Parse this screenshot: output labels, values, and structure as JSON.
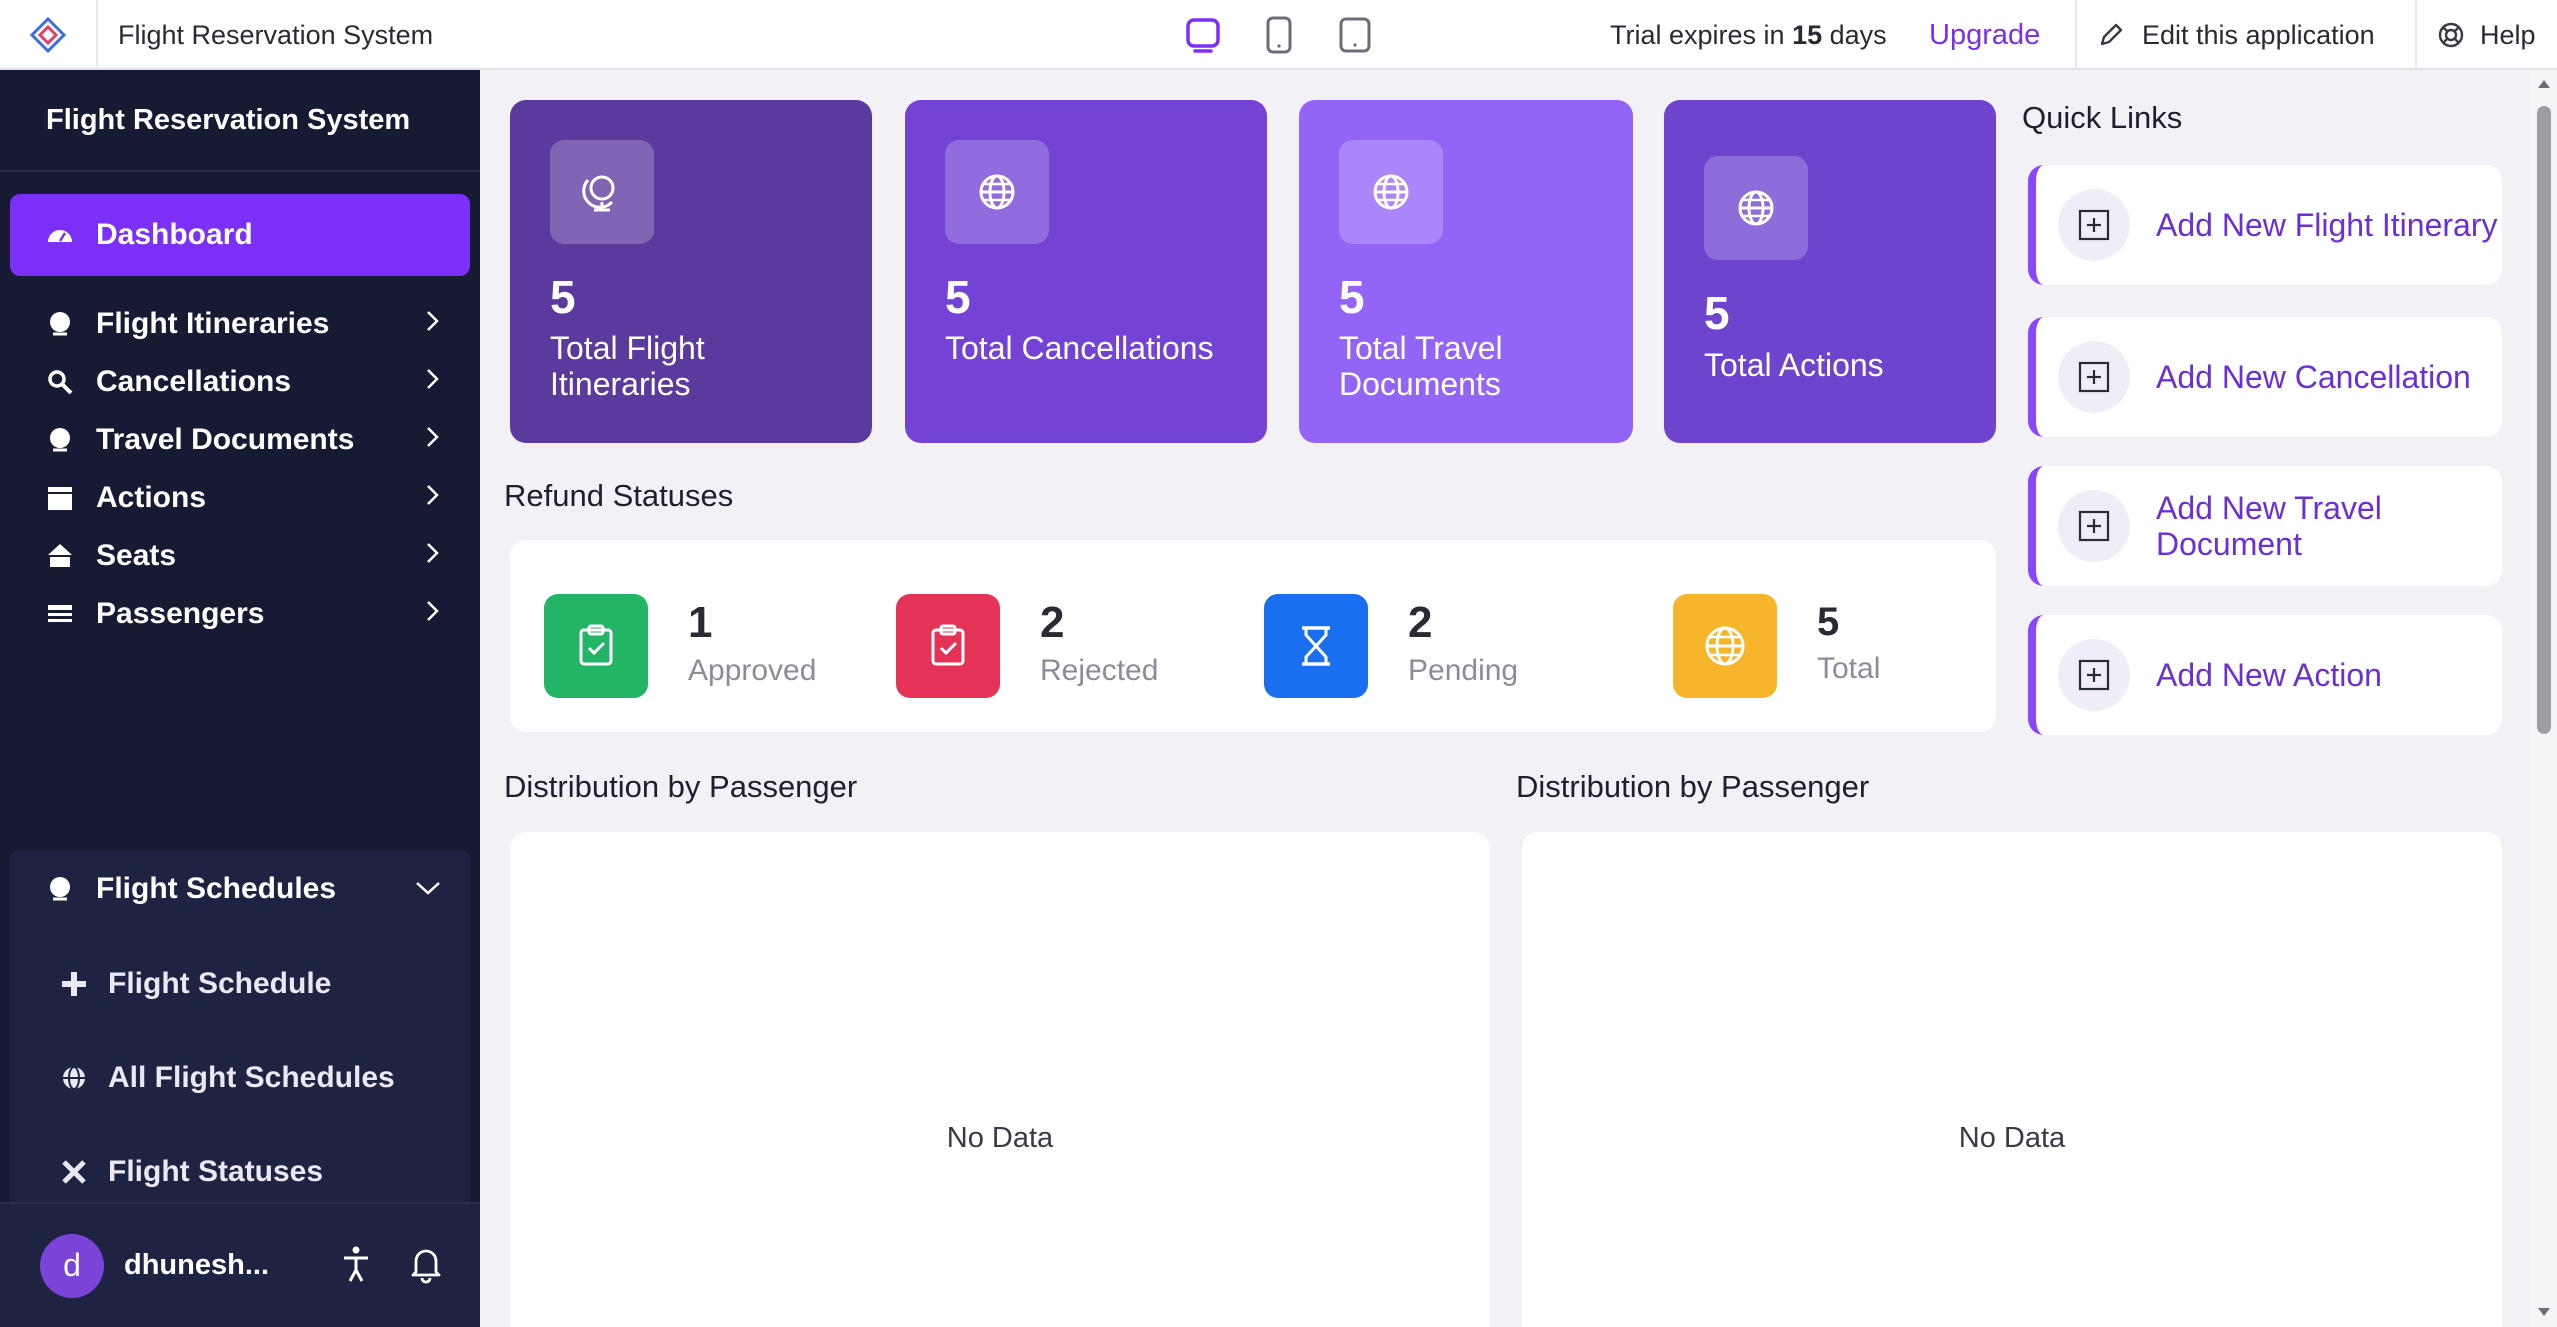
{
  "topbar": {
    "app_title": "Flight Reservation System",
    "trial_prefix": "Trial expires in ",
    "trial_days": "15",
    "trial_suffix": " days",
    "upgrade_label": "Upgrade",
    "edit_label": "Edit this application",
    "help_label": "Help",
    "devices": [
      "desktop-icon",
      "tablet-icon",
      "mobile-icon"
    ]
  },
  "sidebar": {
    "brand": "Flight Reservation System",
    "items": [
      {
        "label": "Dashboard",
        "icon": "dashboard-icon"
      },
      {
        "label": "Flight Itineraries",
        "icon": "globe-icon"
      },
      {
        "label": "Cancellations",
        "icon": "search-icon"
      },
      {
        "label": "Travel Documents",
        "icon": "globe-icon"
      },
      {
        "label": "Actions",
        "icon": "clapper-icon"
      },
      {
        "label": "Seats",
        "icon": "seats-icon"
      },
      {
        "label": "Passengers",
        "icon": "list-icon"
      },
      {
        "label": "Flight Schedules",
        "icon": "globe-icon"
      }
    ],
    "sub_items": [
      {
        "label": "Flight Schedule",
        "icon": "plus-icon"
      },
      {
        "label": "All Flight Schedules",
        "icon": "globe-icon"
      },
      {
        "label": "Flight Statuses",
        "icon": "tools-icon"
      }
    ],
    "user": {
      "initial": "d",
      "name": "dhunesh..."
    }
  },
  "stats": [
    {
      "value": "5",
      "label": "Total Flight Itineraries",
      "color": "#5b3a9e"
    },
    {
      "value": "5",
      "label": "Total Cancellations",
      "color": "#7443d6"
    },
    {
      "value": "5",
      "label": "Total Travel Documents",
      "color": "#9464f7"
    },
    {
      "value": "5",
      "label": "Total Actions",
      "color": "#6e44cf"
    }
  ],
  "refund": {
    "title": "Refund Statuses",
    "items": [
      {
        "value": "1",
        "label": "Approved",
        "color": "#22b566",
        "icon": "clipboard-check-icon"
      },
      {
        "value": "2",
        "label": "Rejected",
        "color": "#e43356",
        "icon": "clipboard-check-icon"
      },
      {
        "value": "2",
        "label": "Pending",
        "color": "#1a6ff0",
        "icon": "hourglass-icon"
      },
      {
        "value": "5",
        "label": "Total",
        "color": "#f7b52b",
        "icon": "globe-icon"
      }
    ]
  },
  "quick_links": {
    "title": "Quick Links",
    "items": [
      {
        "label": "Add New Flight Itinerary"
      },
      {
        "label": "Add New Cancellation"
      },
      {
        "label": "Add New Travel Document"
      },
      {
        "label": "Add New Action"
      }
    ]
  },
  "charts": [
    {
      "title": "Distribution by Passenger",
      "empty_text": "No Data"
    },
    {
      "title": "Distribution by Passenger",
      "empty_text": "No Data"
    }
  ]
}
